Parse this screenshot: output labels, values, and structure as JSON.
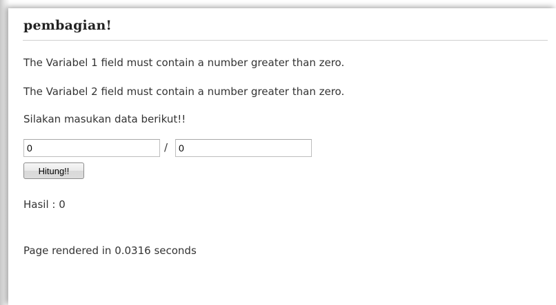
{
  "page": {
    "title": "pembagian!"
  },
  "errors": [
    "The Variabel 1 field must contain a number greater than zero.",
    "The Variabel 2 field must contain a number greater than zero."
  ],
  "form": {
    "prompt": "Silakan masukan data berikut!!",
    "variabel1_value": "0",
    "separator": "/",
    "variabel2_value": "0",
    "submit_label": "Hitung!!"
  },
  "result": {
    "text": "Hasil : 0"
  },
  "footer": {
    "text": "Page rendered in 0.0316 seconds"
  }
}
